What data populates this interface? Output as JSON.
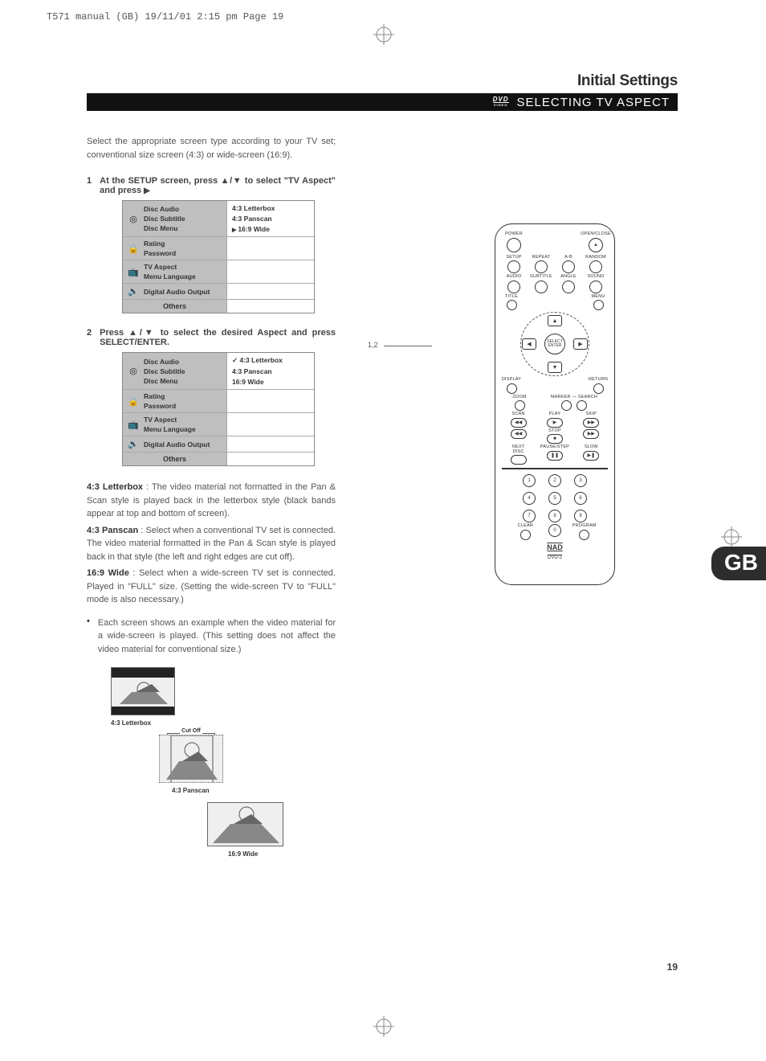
{
  "printHeader": "T571 manual (GB)  19/11/01  2:15 pm  Page 19",
  "header": {
    "initial": "Initial Settings",
    "dvdSub": "VIDEO",
    "barTitle": "SELECTING TV ASPECT"
  },
  "intro": "Select the appropriate screen type according to your TV set; conventional size screen (4:3) or wide-screen (16:9).",
  "step1": {
    "num": "1",
    "text": "At the SETUP screen, press ▲/▼ to select \"TV Aspect\" and press"
  },
  "step2": {
    "num": "2",
    "text": "Press ▲/▼ to select the desired Aspect and press SELECT/ENTER."
  },
  "menu": {
    "grp1": {
      "icon": "◎",
      "items": [
        "Disc Audio",
        "Disc Subtitle",
        "Disc Menu"
      ]
    },
    "grp2": {
      "icon": "🔒",
      "items": [
        "Rating",
        "Password"
      ]
    },
    "grp3": {
      "icon": "📺",
      "items": [
        "TV Aspect",
        "Menu Language"
      ]
    },
    "grp4": {
      "icon": "🔊",
      "items": [
        "Digital Audio Output"
      ]
    },
    "grp5": {
      "label": "Others"
    },
    "opts": [
      "4:3 Letterbox",
      "4:3 Panscan",
      "16:9 Wide"
    ]
  },
  "desc": {
    "p1a": "4:3 Letterbox",
    "p1b": " : The video material not formatted in the Pan & Scan style is played back in the letterbox style (black bands appear at top and bottom of screen).",
    "p2a": "4:3 Panscan",
    "p2b": " : Select when a conventional TV set is connected. The video material formatted in the Pan & Scan style is played back in that style (the left and right edges are cut off).",
    "p3a": "16:9 Wide",
    "p3b": " : Select when a wide-screen TV set is connected. Played in \"FULL\" size. (Setting the wide-screen TV to \"FULL\" mode is also necessary.)"
  },
  "bullet": "Each screen shows an example when the video material for a wide-screen is played. (This setting does not affect the video material for conventional size.)",
  "ex": {
    "lb": "4:3 Letterbox",
    "cut": "Cut Off",
    "ps": "4:3 Panscan",
    "wd": "16:9 Wide"
  },
  "callout": "1,2",
  "remote": {
    "power": "POWER",
    "open": "OPEN/CLOSE",
    "setup": "SETUP",
    "repeat": "REPEAT",
    "ab": "A-B",
    "random": "RANDOM",
    "audio": "AUDIO",
    "subtitle": "SUBTITLE",
    "angle": "ANGLE",
    "sound": "SOUND",
    "title": "TITLE",
    "menuBtn": "MENU",
    "select": "SELECT ENTER",
    "display": "DISPLAY",
    "return": "RETURN",
    "zoom": "ZOOM",
    "marker": "MARKER — SEARCH",
    "scan": "SCAN",
    "play": "PLAY",
    "skip": "SKIP",
    "stop": "STOP",
    "next": "NEXT DISC",
    "pause": "PAUSE/STEP",
    "slow": "SLOW",
    "clear": "CLEAR",
    "program": "PROGRAM",
    "brand": "NAD",
    "model": "DVD-2",
    "n1": "1",
    "n2": "2",
    "n3": "3",
    "n4": "4",
    "n5": "5",
    "n6": "6",
    "n7": "7",
    "n8": "8",
    "n9": "9",
    "n0": "0"
  },
  "gb": "GB",
  "pageNum": "19"
}
